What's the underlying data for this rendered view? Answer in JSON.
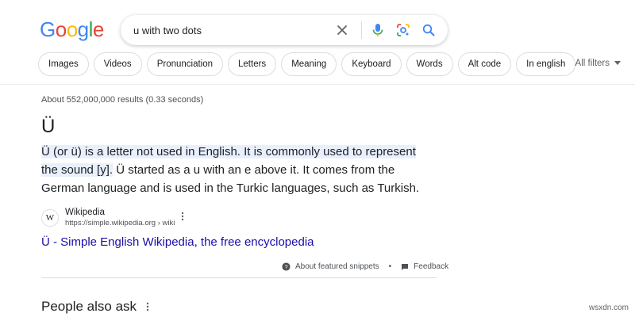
{
  "logo": {
    "letters": [
      "G",
      "o",
      "o",
      "g",
      "l",
      "e"
    ],
    "colors": [
      "#4285F4",
      "#EA4335",
      "#FBBC05",
      "#4285F4",
      "#34A853",
      "#EA4335"
    ]
  },
  "search": {
    "query": "u with two dots"
  },
  "chips": [
    "Images",
    "Videos",
    "Pronunciation",
    "Letters",
    "Meaning",
    "Keyboard",
    "Words",
    "Alt code",
    "In english"
  ],
  "all_filters": "All filters",
  "result_stats": "About 552,000,000 results (0.33 seconds)",
  "snippet": {
    "title": "Ü",
    "line1": "Ü (or ü) is a letter not used in English. It is commonly used to represent",
    "line2_hl": "the sound [y].",
    "line2_rest": " Ü started as a u with an e above it. It comes from the",
    "line3": "German language and is used in the Turkic languages, such as Turkish."
  },
  "source": {
    "favicon": "W",
    "name": "Wikipedia",
    "url": "https://simple.wikipedia.org › wiki"
  },
  "result_link": "Ü - Simple English Wikipedia, the free encyclopedia",
  "footer": {
    "about": "About featured snippets",
    "separator": "•",
    "feedback": "Feedback"
  },
  "people_also_ask": "People also ask",
  "watermark": "wsxdn.com"
}
